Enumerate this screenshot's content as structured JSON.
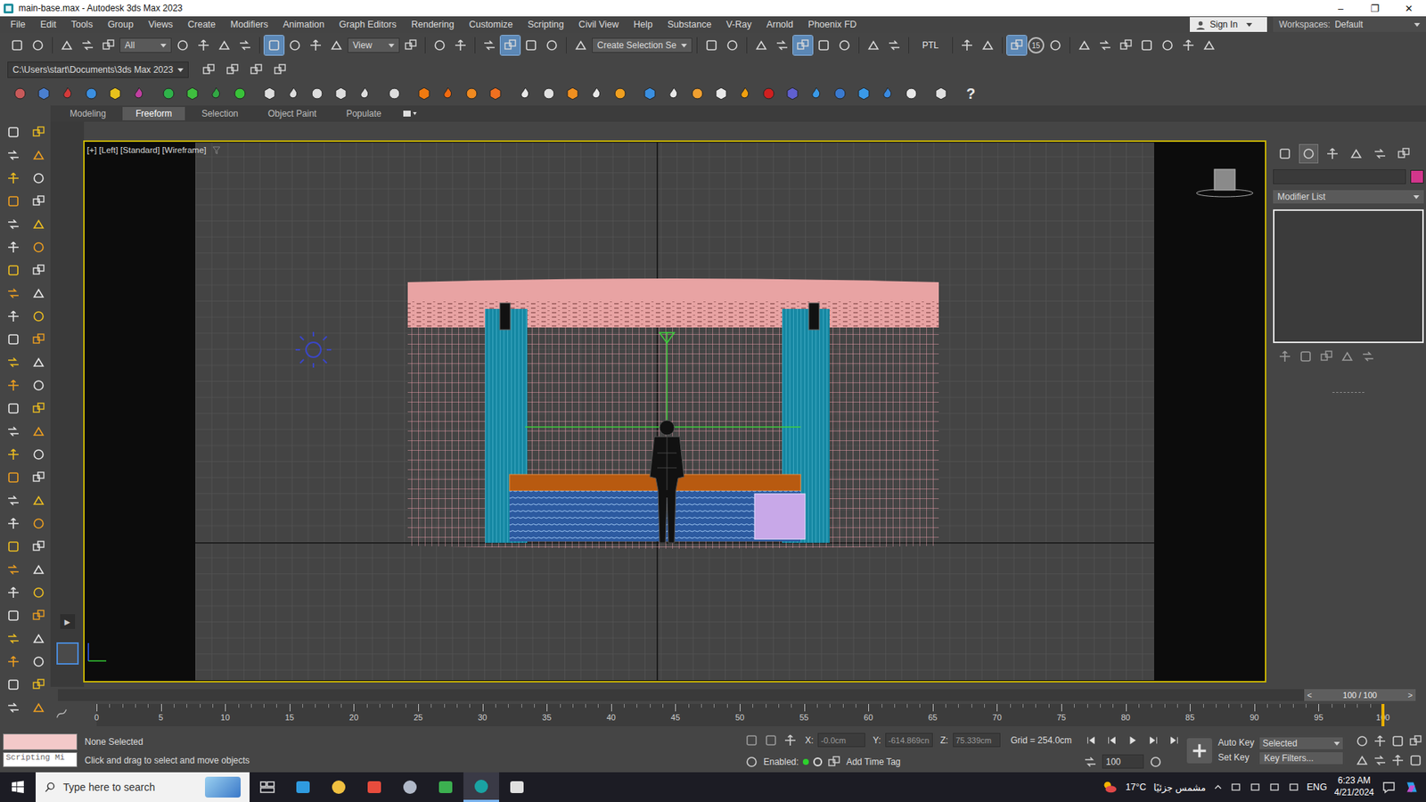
{
  "window": {
    "title": "main-base.max - Autodesk 3ds Max 2023",
    "controls": [
      "–",
      "❐",
      "✕"
    ]
  },
  "menu": [
    "File",
    "Edit",
    "Tools",
    "Group",
    "Views",
    "Create",
    "Modifiers",
    "Animation",
    "Graph Editors",
    "Rendering",
    "Customize",
    "Scripting",
    "Civil View",
    "Help",
    "Substance",
    "V-Ray",
    "Arnold",
    "Phoenix FD"
  ],
  "sign_in": "Sign In",
  "workspaces": {
    "label": "Workspaces:",
    "value": "Default"
  },
  "toolbar": [
    {
      "kind": "icon",
      "active": false
    },
    {
      "kind": "icon",
      "active": false
    },
    {
      "kind": "sep"
    },
    {
      "kind": "icon",
      "active": false
    },
    {
      "kind": "icon",
      "active": false
    },
    {
      "kind": "icon",
      "active": false
    },
    {
      "kind": "dropdown",
      "text": "All"
    },
    {
      "kind": "icon",
      "active": false
    },
    {
      "kind": "icon",
      "active": false
    },
    {
      "kind": "icon",
      "active": false
    },
    {
      "kind": "icon",
      "active": false
    },
    {
      "kind": "sep"
    },
    {
      "kind": "icon",
      "active": true
    },
    {
      "kind": "icon",
      "active": false
    },
    {
      "kind": "icon",
      "active": false
    },
    {
      "kind": "icon",
      "active": false
    },
    {
      "kind": "dropdown",
      "text": "View"
    },
    {
      "kind": "icon",
      "active": false
    },
    {
      "kind": "sep"
    },
    {
      "kind": "icon",
      "active": false
    },
    {
      "kind": "icon",
      "active": false
    },
    {
      "kind": "sep"
    },
    {
      "kind": "icon",
      "active": false
    },
    {
      "kind": "icon",
      "active": true
    },
    {
      "kind": "icon",
      "active": false
    },
    {
      "kind": "icon",
      "active": false
    },
    {
      "kind": "sep"
    },
    {
      "kind": "icon",
      "active": false
    },
    {
      "kind": "dropdown",
      "text": "Create Selection Se"
    },
    {
      "kind": "sep"
    },
    {
      "kind": "icon",
      "active": false
    },
    {
      "kind": "icon",
      "active": false
    },
    {
      "kind": "sep"
    },
    {
      "kind": "icon",
      "active": false
    },
    {
      "kind": "icon",
      "active": false
    },
    {
      "kind": "icon",
      "active": true
    },
    {
      "kind": "icon",
      "active": false
    },
    {
      "kind": "icon",
      "active": false
    },
    {
      "kind": "sep"
    },
    {
      "kind": "icon",
      "active": false
    },
    {
      "kind": "icon",
      "active": false
    },
    {
      "kind": "sep"
    },
    {
      "kind": "label",
      "text": "PTL"
    },
    {
      "kind": "sep"
    },
    {
      "kind": "icon",
      "active": false
    },
    {
      "kind": "icon",
      "active": false
    },
    {
      "kind": "sep"
    },
    {
      "kind": "icon",
      "active": true
    },
    {
      "kind": "badge",
      "text": "15"
    },
    {
      "kind": "icon",
      "active": false
    },
    {
      "kind": "sep"
    },
    {
      "kind": "icon",
      "active": false
    },
    {
      "kind": "icon",
      "active": false
    },
    {
      "kind": "icon",
      "active": false
    },
    {
      "kind": "icon",
      "active": false
    },
    {
      "kind": "icon",
      "active": false
    },
    {
      "kind": "icon",
      "active": false
    },
    {
      "kind": "icon",
      "active": false
    }
  ],
  "project_path": "C:\\Users\\start\\Documents\\3ds Max 2023",
  "help": "?",
  "ribbon_tabs": [
    {
      "label": "Modeling",
      "selected": false
    },
    {
      "label": "Freeform",
      "selected": true
    },
    {
      "label": "Selection",
      "selected": false
    },
    {
      "label": "Object Paint",
      "selected": false
    },
    {
      "label": "Populate",
      "selected": false
    }
  ],
  "layout_toggle": "▶",
  "viewport": {
    "label": "[+] [Left] [Standard] [Wireframe]",
    "active": true
  },
  "command_panel": {
    "tabs": [
      {
        "selected": false
      },
      {
        "selected": true
      },
      {
        "selected": false
      },
      {
        "selected": false
      },
      {
        "selected": false
      },
      {
        "selected": false
      }
    ],
    "object_color": "#d2368c",
    "modifier_list": "Modifier List"
  },
  "timeline": {
    "prev": "<",
    "label": "100 / 100",
    "next": ">",
    "level": 1,
    "ticks": [
      "0",
      "5",
      "10",
      "15",
      "20",
      "25",
      "30",
      "35",
      "40",
      "45",
      "50",
      "55",
      "60",
      "65",
      "70",
      "75",
      "80",
      "85",
      "90",
      "95",
      "100"
    ]
  },
  "status": {
    "selection": "None Selected",
    "prompt": "Click and drag to select and move objects",
    "script_listener": "Scripting Mi",
    "coords": [
      {
        "axis": "X:",
        "value": "-0.0cm"
      },
      {
        "axis": "Y:",
        "value": "-614.869cn"
      },
      {
        "axis": "Z:",
        "value": "75.339cm"
      }
    ],
    "grid": "Grid = 254.0cm",
    "enabled_label": "Enabled:",
    "enabled": true,
    "add_time_tag": "Add Time Tag",
    "frame": "100",
    "auto_key": "Auto Key",
    "key_mode": "Selected",
    "set_key": "Set Key",
    "key_filters": "Key Filters..."
  },
  "taskbar": {
    "search": "Type here to search",
    "apps": [
      {
        "active": false
      },
      {
        "active": false
      },
      {
        "active": false
      },
      {
        "active": false
      },
      {
        "active": false
      },
      {
        "active": false
      },
      {
        "active": true
      },
      {
        "active": false
      }
    ],
    "temperature": "17°C",
    "weather": "مشمس جزئيًا",
    "language": "ENG",
    "time": "6:23 AM",
    "date": "4/21/2024"
  }
}
